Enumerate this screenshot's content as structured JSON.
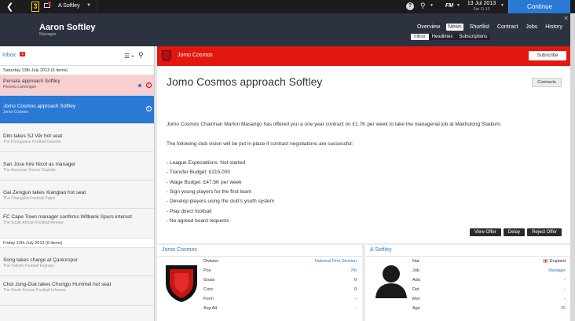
{
  "topbar": {
    "profile": "A Softley",
    "date": "13 Jul 2013",
    "time": "Sat 11:15",
    "fm": "FM",
    "continue": "Continue",
    "help": "?",
    "logo": "3"
  },
  "header": {
    "name": "Aaron Softley",
    "role": "Manager",
    "nav": [
      "Overview",
      "News",
      "Shortlist",
      "Contract",
      "Jobs",
      "History"
    ],
    "subnav": [
      "Inbox",
      "Headlines",
      "Subscriptions"
    ]
  },
  "inbox": {
    "title": "Inbox",
    "count": "1",
    "days": [
      "Saturday 13th July 2013 (6 items)",
      "Friday 12th July 2013 (8 items)"
    ],
    "items": [
      {
        "title": "Persela approach Softley",
        "source": "Persela Lamongan"
      },
      {
        "title": "Jomo Cosmos approach Softley",
        "source": "Jomo Cosmos"
      },
      {
        "title": "Dito takes SJ Vêr hot seat",
        "source": "The Portuguese Football Gazette"
      },
      {
        "title": "San Jose hire Nicol as manager",
        "source": "The American Soccer Gazette"
      },
      {
        "title": "Gai Zengjun takes Xiangtao hot seat",
        "source": "The Changsha Football Paper"
      },
      {
        "title": "FC Cape Town manager confirms Witbank Spurs interest",
        "source": "The South African Football Review"
      },
      {
        "title": "Song takes charge at Çankırspor",
        "source": "The Turkish Football Express"
      },
      {
        "title": "Choi Jong-Duk takes Chungju Hummel hot seat",
        "source": "The South Korean Football Informer"
      }
    ]
  },
  "message": {
    "club": "Jomo Cosmos",
    "subscribe": "Subscribe",
    "headline": "Jomo Cosmos approach Softley",
    "contracts": "Contracts",
    "para1": "Jomo Cosmos Chairman Marlon Masango has offered you a one year contract on £1.7K per week to take the managerial job at Makhulong Stadium.",
    "para2": "The following club vision will be put in place if contract negotiations are successful:",
    "bullets": [
      "- League Expectations: Not started",
      "- Transfer Budget: £215,000",
      "- Wage Budget: £47.5K per week",
      "- Sign young players for the first team",
      "- Develop players using the club's youth system",
      "- Play direct football",
      "- No agreed board requests"
    ],
    "actions": [
      "View Offer",
      "Delay",
      "Reject Offer"
    ]
  },
  "club_panel": {
    "title": "Jomo Cosmos",
    "rows": [
      {
        "k": "Division",
        "v": "National First Division"
      },
      {
        "k": "Pos",
        "v": "7th"
      },
      {
        "k": "Goals",
        "v": "0"
      },
      {
        "k": "Conc",
        "v": "0"
      },
      {
        "k": "Form",
        "v": "-"
      },
      {
        "k": "Avg Att",
        "v": "-"
      }
    ]
  },
  "manager_panel": {
    "title": "A Softley",
    "rows": [
      {
        "k": "Nat",
        "v": "England"
      },
      {
        "k": "Job",
        "v": "Manager"
      },
      {
        "k": "Ada",
        "v": "-"
      },
      {
        "k": "Det",
        "v": "-"
      },
      {
        "k": "Mot",
        "v": "-"
      },
      {
        "k": "Age",
        "v": "25"
      }
    ]
  }
}
